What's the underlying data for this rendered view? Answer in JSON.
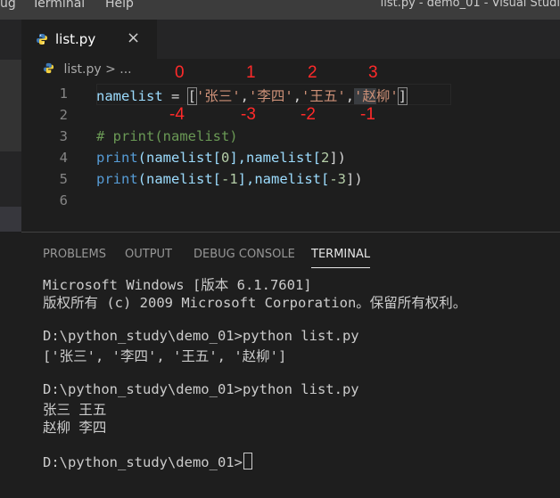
{
  "menu": {
    "items": [
      "ug",
      "Terminal",
      "Help"
    ],
    "window_title": "list.py - demo_01 - Visual Studi"
  },
  "tab": {
    "label": "list.py",
    "close": "×"
  },
  "breadcrumb": {
    "file": "list.py",
    "sep": " > ",
    "rest": "..."
  },
  "editor": {
    "line_numbers": [
      "1",
      "2",
      "3",
      "4",
      "5",
      "6"
    ],
    "line1": {
      "var": "namelist",
      "op": " = ",
      "open": "[",
      "s1": "'张三'",
      "c1": ",",
      "s2": "'李四'",
      "c2": ",",
      "s3": "'王五'",
      "c3": ",",
      "s4a": "'赵",
      "s4b": "柳",
      "s4c": "'",
      "close": "]"
    },
    "line3": "# print(namelist)",
    "line4": {
      "fn": "print",
      "a": "(namelist[",
      "n1": "0",
      "b": "],namelist[",
      "n2": "2",
      "c": "])"
    },
    "line5": {
      "fn": "print",
      "a": "(namelist[",
      "n1": "-1",
      "b": "],namelist[",
      "n2": "-3",
      "c": "])"
    }
  },
  "annotations": {
    "top": [
      "0",
      "1",
      "2",
      "3"
    ],
    "bottom": [
      "-4",
      "-3",
      "-2",
      "-1"
    ]
  },
  "panel": {
    "tabs": [
      "PROBLEMS",
      "OUTPUT",
      "DEBUG CONSOLE",
      "TERMINAL"
    ],
    "active_tab": "TERMINAL"
  },
  "terminal": {
    "lines": [
      "Microsoft Windows [版本 6.1.7601]",
      "版权所有 (c) 2009 Microsoft Corporation。保留所有权利。",
      "",
      "D:\\python_study\\demo_01>python list.py",
      "['张三', '李四', '王五', '赵柳']",
      "",
      "D:\\python_study\\demo_01>python list.py",
      "张三 王五",
      "赵柳 李四",
      "",
      "D:\\python_study\\demo_01>"
    ]
  },
  "colors": {
    "annotation": "#ff2a2a",
    "python_icon_blue": "#3e7ab8",
    "python_icon_yellow": "#f4d03f"
  }
}
